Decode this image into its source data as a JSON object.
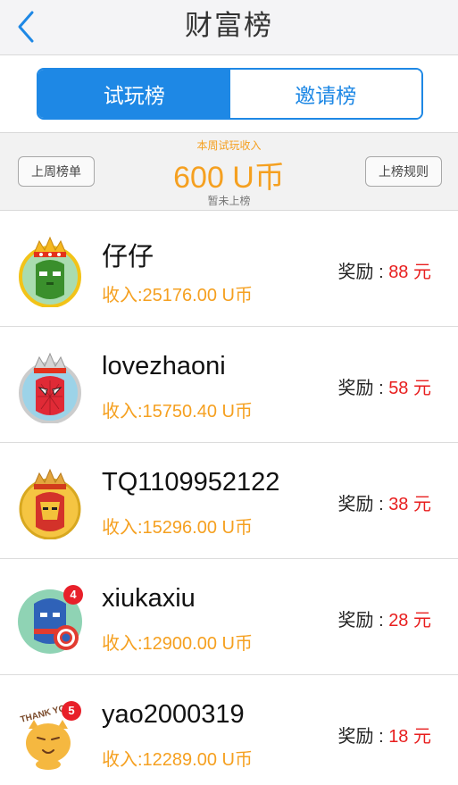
{
  "header": {
    "title": "财富榜",
    "back_icon": "chevron-left-icon"
  },
  "tabs": [
    {
      "label": "试玩榜",
      "active": true
    },
    {
      "label": "邀请榜",
      "active": false
    }
  ],
  "summary": {
    "label": "本周试玩收入",
    "amount": "600 U币",
    "status": "暂未上榜",
    "left_button": "上周榜单",
    "right_button": "上榜规则"
  },
  "colors": {
    "accent": "#1e88e5",
    "orange": "#f5a020",
    "red": "#e81e1e"
  },
  "ranking": [
    {
      "name": "仔仔",
      "income": "收入:25176.00 U币",
      "reward_label": "奖励",
      "reward_sep": ":",
      "reward_value": "88 元",
      "avatar": "hulk-crown-avatar"
    },
    {
      "name": "lovezhaoni",
      "income": "收入:15750.40 U币",
      "reward_label": "奖励",
      "reward_sep": ":",
      "reward_value": "58 元",
      "avatar": "spiderman-crown-avatar"
    },
    {
      "name": "TQ1109952122",
      "income": "收入:15296.00 U币",
      "reward_label": "奖励",
      "reward_sep": ":",
      "reward_value": "38 元",
      "avatar": "ironman-crown-avatar"
    },
    {
      "name": "xiukaxiu",
      "income": "收入:12900.00 U币",
      "reward_label": "奖励",
      "reward_sep": ":",
      "reward_value": "28 元",
      "avatar": "captain-america-avatar",
      "rank_badge": "4"
    },
    {
      "name": "yao2000319",
      "income": "收入:12289.00 U币",
      "reward_label": "奖励",
      "reward_sep": ":",
      "reward_value": "18 元",
      "avatar": "thank-you-cat-avatar",
      "rank_badge": "5",
      "avatar_text": "THANK YOU"
    }
  ]
}
